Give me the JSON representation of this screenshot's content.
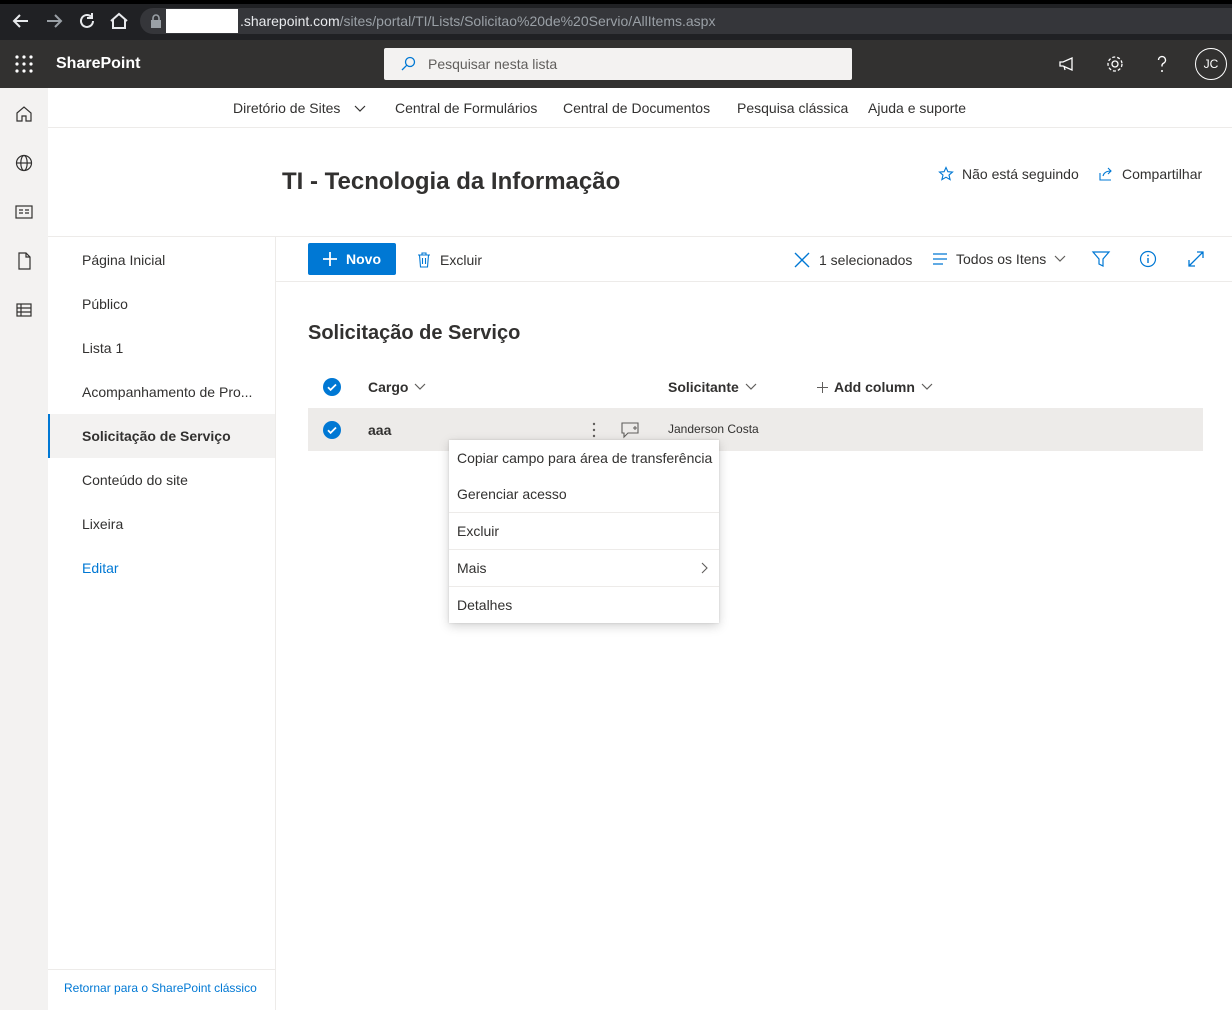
{
  "browser": {
    "url_host": ".sharepoint.com",
    "url_path": "/sites/portal/TI/Lists/Solicitao%20de%20Servio/AllItems.aspx"
  },
  "suite": {
    "brand": "SharePoint",
    "search_placeholder": "Pesquisar nesta lista",
    "avatar_initials": "JC"
  },
  "hub_nav": {
    "items": [
      "Diretório de Sites",
      "Central de Formulários",
      "Central de Documentos",
      "Pesquisa clássica",
      "Ajuda e suporte"
    ]
  },
  "site": {
    "title": "TI - Tecnologia da Informação",
    "follow_label": "Não está seguindo",
    "share_label": "Compartilhar"
  },
  "left_nav": {
    "items": [
      "Página Inicial",
      "Público",
      "Lista 1",
      "Acompanhamento de Pro...",
      "Solicitação de Serviço",
      "Conteúdo do site",
      "Lixeira"
    ],
    "edit_label": "Editar",
    "footer_link": "Retornar para o SharePoint clássico"
  },
  "command_bar": {
    "new_label": "Novo",
    "delete_label": "Excluir",
    "selected_label": "1 selecionados",
    "view_label": "Todos os Itens"
  },
  "list": {
    "title": "Solicitação de Serviço",
    "columns": [
      "Cargo",
      "Solicitante",
      "Add column"
    ],
    "rows": [
      {
        "cargo": "aaa",
        "solicitante": "Janderson Costa"
      }
    ]
  },
  "context_menu": {
    "items": [
      "Copiar campo para área de transferência",
      "Gerenciar acesso",
      "Excluir",
      "Mais",
      "Detalhes"
    ]
  },
  "colors": {
    "accent": "#0078d4",
    "suite_bar": "#323130",
    "browser_bar": "#202124"
  }
}
